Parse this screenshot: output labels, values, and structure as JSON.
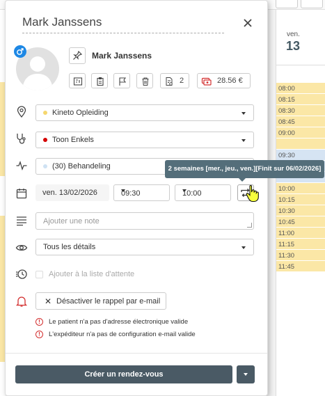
{
  "calendar": {
    "day_name": "ven.",
    "day_number": "13",
    "slots": [
      {
        "time": "08:00",
        "kind": "y"
      },
      {
        "time": "08:15",
        "kind": "y"
      },
      {
        "time": "08:30",
        "kind": "y"
      },
      {
        "time": "08:45",
        "kind": "y"
      },
      {
        "time": "09:00",
        "kind": "y"
      },
      {
        "time": "",
        "kind": "y"
      },
      {
        "time": "09:30",
        "kind": "b"
      },
      {
        "time": "",
        "kind": "b"
      },
      {
        "time": "",
        "kind": "b"
      },
      {
        "time": "10:00",
        "kind": "y"
      },
      {
        "time": "10:15",
        "kind": "y"
      },
      {
        "time": "10:30",
        "kind": "y"
      },
      {
        "time": "10:45",
        "kind": "y"
      },
      {
        "time": "11:00",
        "kind": "y"
      },
      {
        "time": "11:15",
        "kind": "y"
      },
      {
        "time": "11:30",
        "kind": "y"
      },
      {
        "time": "11:45",
        "kind": "y"
      }
    ]
  },
  "popup": {
    "title": "Mark Janssens",
    "patient_name": "Mark Janssens",
    "appointments_count": "2",
    "balance": "28.56 €",
    "location": {
      "label": "Kineto Opleiding",
      "dot_color": "#f5d76e"
    },
    "practitioner": {
      "label": "Toon Enkels",
      "dot_color": "#d50000"
    },
    "treatment": {
      "label": "(30) Behandeling",
      "dot_color": "#cfe2f3"
    },
    "date": "ven. 13/02/2026",
    "start_time": "09:30",
    "end_time": "10:00",
    "note_placeholder": "Ajouter une note",
    "details_select": "Tous les détails",
    "waitlist_label": "Ajouter à la liste d'attente",
    "reminder_button": "Désactiver le rappel par e-mail",
    "warnings": [
      "Le patient n'a pas d'adresse électronique valide",
      "L'expéditeur n'a pas de configuration e-mail valide"
    ],
    "create_button": "Créer un rendez-vous"
  },
  "tooltip": "2 semaines [mer., jeu., ven.][Finit sur 06/02/2026]",
  "colors": {
    "accent": "#4a5a65",
    "tooltip_bg": "#546e7a",
    "slot_yellow": "#fbe7a6",
    "slot_blue": "#d6e4f3",
    "warning": "#d32f2f",
    "gender_badge": "#1e88e5"
  }
}
